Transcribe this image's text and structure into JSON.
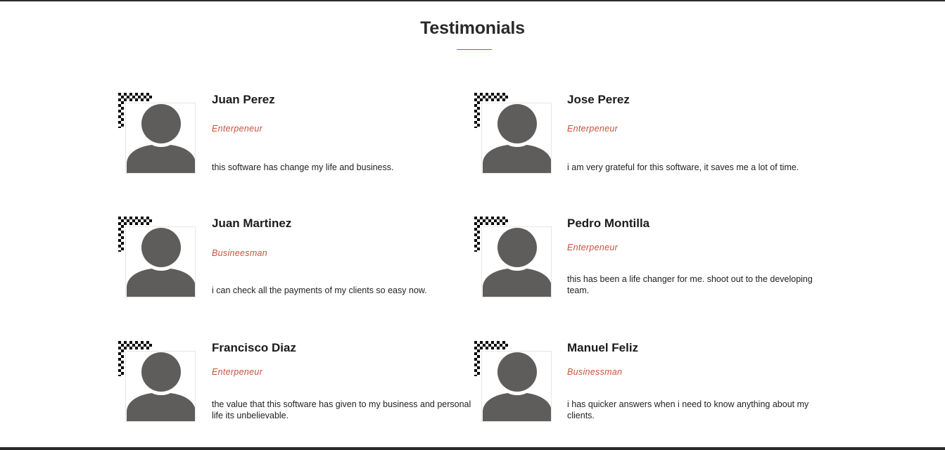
{
  "section": {
    "title": "Testimonials"
  },
  "colors": {
    "accent": "#c8503a",
    "avatar_gray": "#5f5d5c"
  },
  "testimonials": [
    {
      "name": "Juan Perez",
      "role": "Enterpeneur",
      "quote": "this software has change my life and business.",
      "icon": "user-avatar-icon"
    },
    {
      "name": "Jose Perez",
      "role": "Enterpeneur",
      "quote": "i am very grateful for this software, it saves me a lot of time.",
      "icon": "user-avatar-icon"
    },
    {
      "name": "Juan Martinez",
      "role": "Busineesman",
      "quote": "i can check all the payments of my clients so easy now.",
      "icon": "user-avatar-icon"
    },
    {
      "name": "Pedro Montilla",
      "role": "Enterpeneur",
      "quote": "this has been a life changer for me. shoot out to the developing team.",
      "icon": "user-avatar-icon"
    },
    {
      "name": "Francisco Diaz",
      "role": "Enterpeneur",
      "quote": "the value that this software has given to my business and personal life its unbelievable.",
      "icon": "user-avatar-icon"
    },
    {
      "name": "Manuel Feliz",
      "role": "Businessman",
      "quote": "i has quicker answers when i need to know anything about my clients.",
      "icon": "user-avatar-icon"
    }
  ]
}
